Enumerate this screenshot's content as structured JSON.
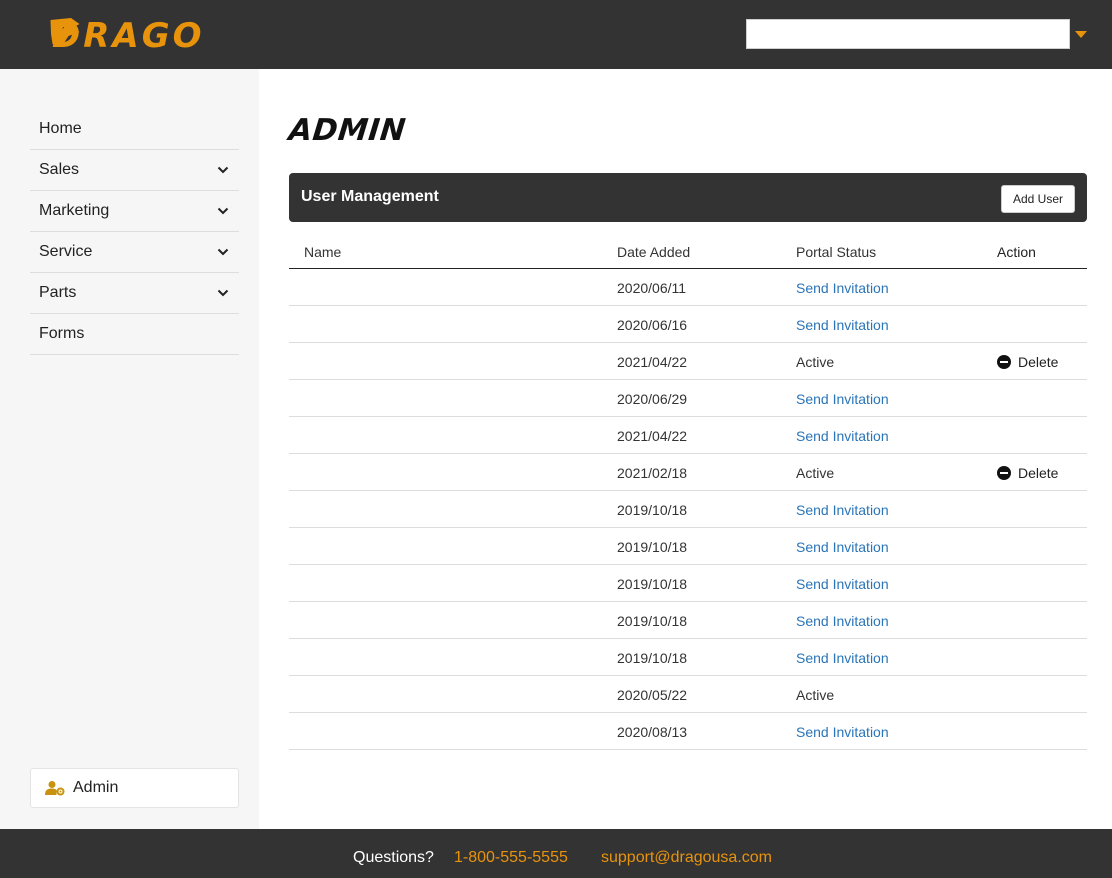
{
  "brand": {
    "logo_text": "DRAGO",
    "accent_color": "#e8930c",
    "header_color": "#333333"
  },
  "header": {
    "dealer_select_value": ""
  },
  "sidebar": {
    "items": [
      {
        "label": "Home",
        "expandable": false
      },
      {
        "label": "Sales",
        "expandable": true
      },
      {
        "label": "Marketing",
        "expandable": true
      },
      {
        "label": "Service",
        "expandable": true
      },
      {
        "label": "Parts",
        "expandable": true
      },
      {
        "label": "Forms",
        "expandable": false
      }
    ],
    "admin_label": "Admin",
    "admin_icon": "user-gear-icon"
  },
  "main": {
    "title": "ADMIN",
    "panel_title": "User Management",
    "add_user_label": "Add User",
    "columns": {
      "name": "Name",
      "date": "Date Added",
      "status": "Portal Status",
      "action": "Action"
    },
    "rows": [
      {
        "name": "",
        "date": "2020/06/11",
        "status": "Send Invitation",
        "status_type": "link",
        "action": ""
      },
      {
        "name": "",
        "date": "2020/06/16",
        "status": "Send Invitation",
        "status_type": "link",
        "action": ""
      },
      {
        "name": "",
        "date": "2021/04/22",
        "status": "Active",
        "status_type": "text",
        "action": "Delete"
      },
      {
        "name": "",
        "date": "2020/06/29",
        "status": "Send Invitation",
        "status_type": "link",
        "action": ""
      },
      {
        "name": "",
        "date": "2021/04/22",
        "status": "Send Invitation",
        "status_type": "link",
        "action": ""
      },
      {
        "name": "",
        "date": "2021/02/18",
        "status": "Active",
        "status_type": "text",
        "action": "Delete"
      },
      {
        "name": "",
        "date": "2019/10/18",
        "status": "Send Invitation",
        "status_type": "link",
        "action": ""
      },
      {
        "name": "",
        "date": "2019/10/18",
        "status": "Send Invitation",
        "status_type": "link",
        "action": ""
      },
      {
        "name": "",
        "date": "2019/10/18",
        "status": "Send Invitation",
        "status_type": "link",
        "action": ""
      },
      {
        "name": "",
        "date": "2019/10/18",
        "status": "Send Invitation",
        "status_type": "link",
        "action": ""
      },
      {
        "name": "",
        "date": "2019/10/18",
        "status": "Send Invitation",
        "status_type": "link",
        "action": ""
      },
      {
        "name": "",
        "date": "2020/05/22",
        "status": "Active",
        "status_type": "text",
        "action": ""
      },
      {
        "name": "",
        "date": "2020/08/13",
        "status": "Send Invitation",
        "status_type": "link",
        "action": ""
      }
    ],
    "link_color": "#2a75b8"
  },
  "footer": {
    "questions": "Questions?",
    "phone": "1-800-555-5555",
    "email": "support@dragousa.com"
  }
}
